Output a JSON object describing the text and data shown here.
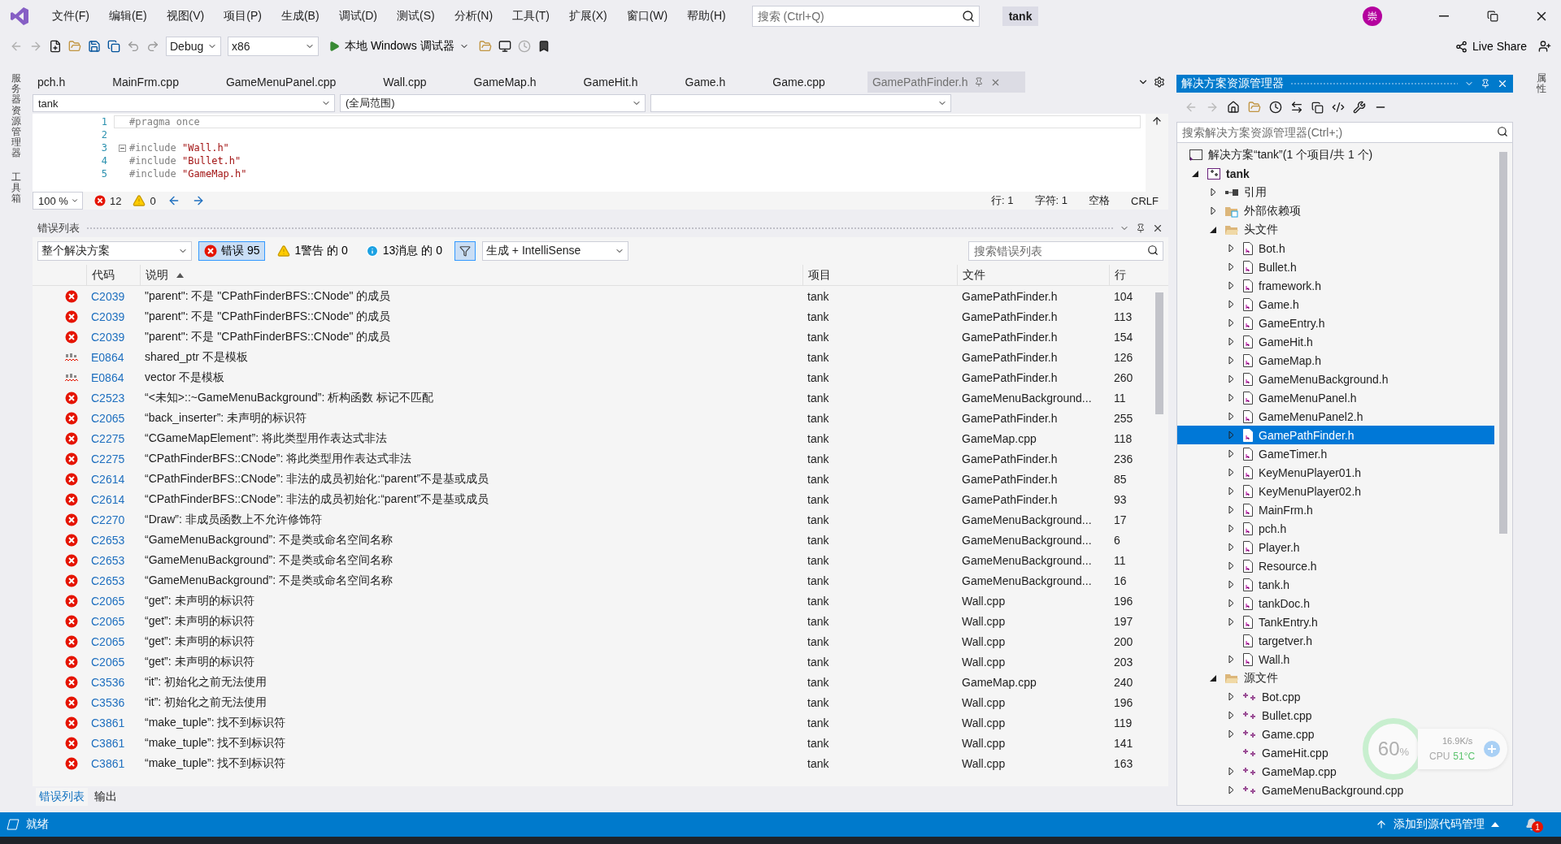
{
  "title_bar": {
    "menu": [
      "文件(F)",
      "编辑(E)",
      "视图(V)",
      "项目(P)",
      "生成(B)",
      "调试(D)",
      "测试(S)",
      "分析(N)",
      "工具(T)",
      "扩展(X)",
      "窗口(W)",
      "帮助(H)"
    ],
    "search_placeholder": "搜索 (Ctrl+Q)",
    "solution_name": "tank",
    "avatar": "崇"
  },
  "toolbar": {
    "configuration": "Debug",
    "platform": "x86",
    "run": "本地 Windows 调试器",
    "live_share": "Live Share"
  },
  "side_left": [
    "服务器资源管理器",
    "工具箱"
  ],
  "side_right": [
    "属性"
  ],
  "tabs": [
    {
      "label": "pch.h",
      "selected": false
    },
    {
      "label": "MainFrm.cpp",
      "selected": false
    },
    {
      "label": "GameMenuPanel.cpp",
      "selected": false
    },
    {
      "label": "Wall.cpp",
      "selected": false
    },
    {
      "label": "GameMap.h",
      "selected": false
    },
    {
      "label": "GameHit.h",
      "selected": false
    },
    {
      "label": "Game.h",
      "selected": false
    },
    {
      "label": "Game.cpp",
      "selected": false
    },
    {
      "label": "GamePathFinder.h",
      "selected": true
    }
  ],
  "editor": {
    "nav": [
      "tank",
      "(全局范围)"
    ],
    "lines": [
      {
        "number": "1",
        "kind": "pragma",
        "text": "#pragma once"
      },
      {
        "number": "2",
        "kind": "blank"
      },
      {
        "number": "3",
        "kind": "include",
        "text": "#include",
        "string": "\"Wall.h\"",
        "fold": true
      },
      {
        "number": "4",
        "kind": "include",
        "text": "#include",
        "string": "\"Bullet.h\""
      },
      {
        "number": "5",
        "kind": "include",
        "text": "#include",
        "string": "\"GameMap.h\""
      }
    ],
    "zoom": "100 %",
    "errors": "12",
    "warnings": "0",
    "status": [
      "行: 1",
      "字符: 1",
      "空格",
      "CRLF"
    ]
  },
  "error_list": {
    "title": "错误列表",
    "scope": "整个解决方案",
    "filters": [
      {
        "kind": "error",
        "label": "错误 95",
        "selected": true
      },
      {
        "kind": "warning",
        "label": "1警告 的 0",
        "selected": false
      },
      {
        "kind": "info",
        "label": "13消息 的 0",
        "selected": false
      }
    ],
    "source": "生成 + IntelliSense",
    "search_placeholder": "搜索错误列表",
    "columns": [
      {
        "label": "代码",
        "sorted": false
      },
      {
        "label": "说明",
        "sorted": true
      },
      {
        "label": "项目",
        "sorted": false
      },
      {
        "label": "文件",
        "sorted": false
      },
      {
        "label": "行",
        "sorted": false
      }
    ],
    "rows": [
      {
        "kind": "error",
        "code": "C2039",
        "description": "\"parent\": 不是 \"CPathFinderBFS::CNode\" 的成员",
        "project": "tank",
        "file": "GamePathFinder.h",
        "line": "104"
      },
      {
        "kind": "error",
        "code": "C2039",
        "description": "\"parent\": 不是 \"CPathFinderBFS::CNode\" 的成员",
        "project": "tank",
        "file": "GamePathFinder.h",
        "line": "113"
      },
      {
        "kind": "error",
        "code": "C2039",
        "description": "\"parent\": 不是 \"CPathFinderBFS::CNode\" 的成员",
        "project": "tank",
        "file": "GamePathFinder.h",
        "line": "154"
      },
      {
        "kind": "intellisense",
        "code": "E0864",
        "description": "shared_ptr 不是模板",
        "project": "tank",
        "file": "GamePathFinder.h",
        "line": "126"
      },
      {
        "kind": "intellisense",
        "code": "E0864",
        "description": "vector 不是模板",
        "project": "tank",
        "file": "GamePathFinder.h",
        "line": "260"
      },
      {
        "kind": "error",
        "code": "C2523",
        "description": "“<未知>::~GameMenuBackground”: 析构函数 标记不匹配",
        "project": "tank",
        "file": "GameMenuBackground...",
        "line": "11"
      },
      {
        "kind": "error",
        "code": "C2065",
        "description": "“back_inserter”: 未声明的标识符",
        "project": "tank",
        "file": "GamePathFinder.h",
        "line": "255"
      },
      {
        "kind": "error",
        "code": "C2275",
        "description": "“CGameMapElement”: 将此类型用作表达式非法",
        "project": "tank",
        "file": "GameMap.cpp",
        "line": "118"
      },
      {
        "kind": "error",
        "code": "C2275",
        "description": "“CPathFinderBFS::CNode”: 将此类型用作表达式非法",
        "project": "tank",
        "file": "GamePathFinder.h",
        "line": "236"
      },
      {
        "kind": "error",
        "code": "C2614",
        "description": "“CPathFinderBFS::CNode”: 非法的成员初始化:“parent”不是基或成员",
        "project": "tank",
        "file": "GamePathFinder.h",
        "line": "85"
      },
      {
        "kind": "error",
        "code": "C2614",
        "description": "“CPathFinderBFS::CNode”: 非法的成员初始化:“parent”不是基或成员",
        "project": "tank",
        "file": "GamePathFinder.h",
        "line": "93"
      },
      {
        "kind": "error",
        "code": "C2270",
        "description": "“Draw”: 非成员函数上不允许修饰符",
        "project": "tank",
        "file": "GameMenuBackground...",
        "line": "17"
      },
      {
        "kind": "error",
        "code": "C2653",
        "description": "“GameMenuBackground”: 不是类或命名空间名称",
        "project": "tank",
        "file": "GameMenuBackground...",
        "line": "6"
      },
      {
        "kind": "error",
        "code": "C2653",
        "description": "“GameMenuBackground”: 不是类或命名空间名称",
        "project": "tank",
        "file": "GameMenuBackground...",
        "line": "11"
      },
      {
        "kind": "error",
        "code": "C2653",
        "description": "“GameMenuBackground”: 不是类或命名空间名称",
        "project": "tank",
        "file": "GameMenuBackground...",
        "line": "16"
      },
      {
        "kind": "error",
        "code": "C2065",
        "description": "“get”: 未声明的标识符",
        "project": "tank",
        "file": "Wall.cpp",
        "line": "196"
      },
      {
        "kind": "error",
        "code": "C2065",
        "description": "“get”: 未声明的标识符",
        "project": "tank",
        "file": "Wall.cpp",
        "line": "197"
      },
      {
        "kind": "error",
        "code": "C2065",
        "description": "“get”: 未声明的标识符",
        "project": "tank",
        "file": "Wall.cpp",
        "line": "200"
      },
      {
        "kind": "error",
        "code": "C2065",
        "description": "“get”: 未声明的标识符",
        "project": "tank",
        "file": "Wall.cpp",
        "line": "203"
      },
      {
        "kind": "error",
        "code": "C3536",
        "description": "“it”: 初始化之前无法使用",
        "project": "tank",
        "file": "GameMap.cpp",
        "line": "240"
      },
      {
        "kind": "error",
        "code": "C3536",
        "description": "“it”: 初始化之前无法使用",
        "project": "tank",
        "file": "Wall.cpp",
        "line": "196"
      },
      {
        "kind": "error",
        "code": "C3861",
        "description": "“make_tuple”: 找不到标识符",
        "project": "tank",
        "file": "Wall.cpp",
        "line": "119"
      },
      {
        "kind": "error",
        "code": "C3861",
        "description": "“make_tuple”: 找不到标识符",
        "project": "tank",
        "file": "Wall.cpp",
        "line": "141"
      },
      {
        "kind": "error",
        "code": "C3861",
        "description": "“make_tuple”: 找不到标识符",
        "project": "tank",
        "file": "Wall.cpp",
        "line": "163"
      }
    ]
  },
  "bottom_tabs": [
    {
      "label": "错误列表",
      "selected": true
    },
    {
      "label": "输出",
      "selected": false
    }
  ],
  "solution_explorer": {
    "title": "解决方案资源管理器",
    "search_placeholder": "搜索解决方案资源管理器(Ctrl+;)",
    "tree": [
      {
        "kind": "solution",
        "label": "解决方案“tank”(1 个项目/共 1 个)",
        "selected": false,
        "children": [
          {
            "kind": "project",
            "label": "tank",
            "selected": false,
            "expanded": true,
            "children": [
              {
                "kind": "references",
                "label": "引用",
                "selected": false,
                "expanded": false
              },
              {
                "kind": "external",
                "label": "外部依赖项",
                "selected": false,
                "expanded": false
              },
              {
                "kind": "folder",
                "label": "头文件",
                "selected": false,
                "expanded": true,
                "children": [
                  {
                    "kind": "header",
                    "label": "Bot.h",
                    "selected": false,
                    "expanded": false
                  },
                  {
                    "kind": "header",
                    "label": "Bullet.h",
                    "selected": false,
                    "expanded": false
                  },
                  {
                    "kind": "header",
                    "label": "framework.h",
                    "selected": false,
                    "expanded": false
                  },
                  {
                    "kind": "header",
                    "label": "Game.h",
                    "selected": false,
                    "expanded": false
                  },
                  {
                    "kind": "header",
                    "label": "GameEntry.h",
                    "selected": false,
                    "expanded": false
                  },
                  {
                    "kind": "header",
                    "label": "GameHit.h",
                    "selected": false,
                    "expanded": false
                  },
                  {
                    "kind": "header",
                    "label": "GameMap.h",
                    "selected": false,
                    "expanded": false
                  },
                  {
                    "kind": "header",
                    "label": "GameMenuBackground.h",
                    "selected": false,
                    "expanded": false
                  },
                  {
                    "kind": "header",
                    "label": "GameMenuPanel.h",
                    "selected": false,
                    "expanded": false
                  },
                  {
                    "kind": "header",
                    "label": "GameMenuPanel2.h",
                    "selected": false,
                    "expanded": false
                  },
                  {
                    "kind": "header",
                    "label": "GamePathFinder.h",
                    "selected": true,
                    "expanded": false
                  },
                  {
                    "kind": "header",
                    "label": "GameTimer.h",
                    "selected": false,
                    "expanded": false
                  },
                  {
                    "kind": "header",
                    "label": "KeyMenuPlayer01.h",
                    "selected": false,
                    "expanded": false
                  },
                  {
                    "kind": "header",
                    "label": "KeyMenuPlayer02.h",
                    "selected": false,
                    "expanded": false
                  },
                  {
                    "kind": "header",
                    "label": "MainFrm.h",
                    "selected": false,
                    "expanded": false
                  },
                  {
                    "kind": "header",
                    "label": "pch.h",
                    "selected": false,
                    "expanded": false
                  },
                  {
                    "kind": "header",
                    "label": "Player.h",
                    "selected": false,
                    "expanded": false
                  },
                  {
                    "kind": "header",
                    "label": "Resource.h",
                    "selected": false,
                    "expanded": false
                  },
                  {
                    "kind": "header",
                    "label": "tank.h",
                    "selected": false,
                    "expanded": false
                  },
                  {
                    "kind": "header",
                    "label": "tankDoc.h",
                    "selected": false,
                    "expanded": false
                  },
                  {
                    "kind": "header",
                    "label": "TankEntry.h",
                    "selected": false,
                    "expanded": false
                  },
                  {
                    "kind": "header",
                    "label": "targetver.h",
                    "selected": false
                  },
                  {
                    "kind": "header",
                    "label": "Wall.h",
                    "selected": false,
                    "expanded": false
                  }
                ]
              },
              {
                "kind": "folder",
                "label": "源文件",
                "selected": false,
                "expanded": true,
                "children": [
                  {
                    "kind": "source",
                    "label": "Bot.cpp",
                    "selected": false,
                    "expanded": false
                  },
                  {
                    "kind": "source",
                    "label": "Bullet.cpp",
                    "selected": false,
                    "expanded": false
                  },
                  {
                    "kind": "source",
                    "label": "Game.cpp",
                    "selected": false,
                    "expanded": false
                  },
                  {
                    "kind": "source",
                    "label": "GameHit.cpp",
                    "selected": false
                  },
                  {
                    "kind": "source",
                    "label": "GameMap.cpp",
                    "selected": false,
                    "expanded": false
                  },
                  {
                    "kind": "source",
                    "label": "GameMenuBackground.cpp",
                    "selected": false,
                    "expanded": false
                  }
                ]
              }
            ]
          }
        ]
      }
    ]
  },
  "status_bar": {
    "text": "就绪",
    "source_control": "添加到源代码管理",
    "notifications": "1"
  },
  "monitor_widget": {
    "percent": "60",
    "unit": "%",
    "speed": "16.9K/s",
    "cpu_label": "CPU",
    "cpu_temp": "51°C"
  }
}
